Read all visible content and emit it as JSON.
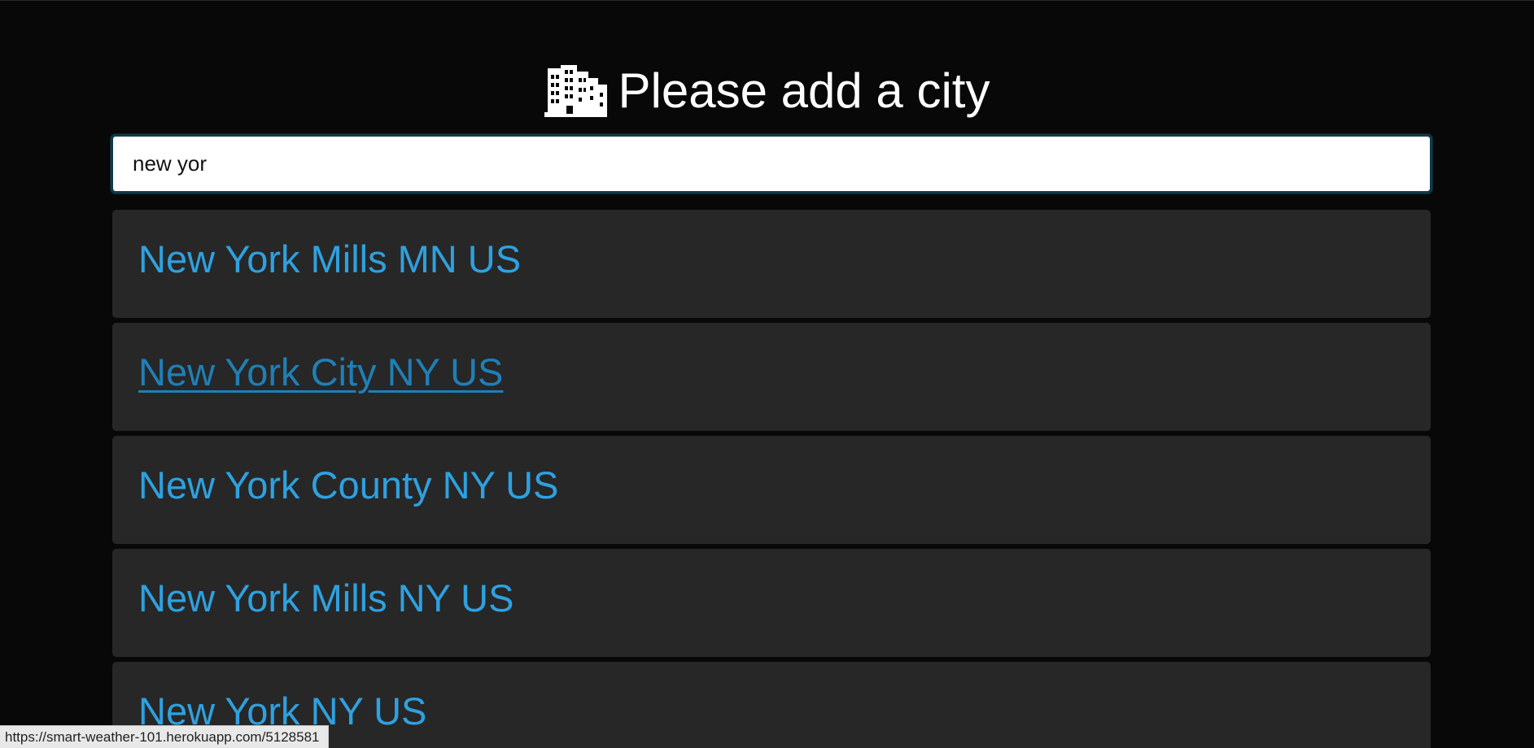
{
  "header": {
    "icon": "city-icon",
    "title": "Please add a city"
  },
  "search": {
    "value": "new yor",
    "placeholder": ""
  },
  "results": [
    {
      "label": "New York Mills MN US",
      "hovered": false
    },
    {
      "label": "New York City NY US",
      "hovered": true
    },
    {
      "label": "New York County NY US",
      "hovered": false
    },
    {
      "label": "New York Mills NY US",
      "hovered": false
    },
    {
      "label": "New York NY US",
      "hovered": false
    }
  ],
  "status_bar": {
    "url": "https://smart-weather-101.herokuapp.com/5128581"
  },
  "colors": {
    "background": "#080808",
    "card": "#272727",
    "link": "#2ea1e0",
    "link_hover": "#1f7fb6"
  }
}
